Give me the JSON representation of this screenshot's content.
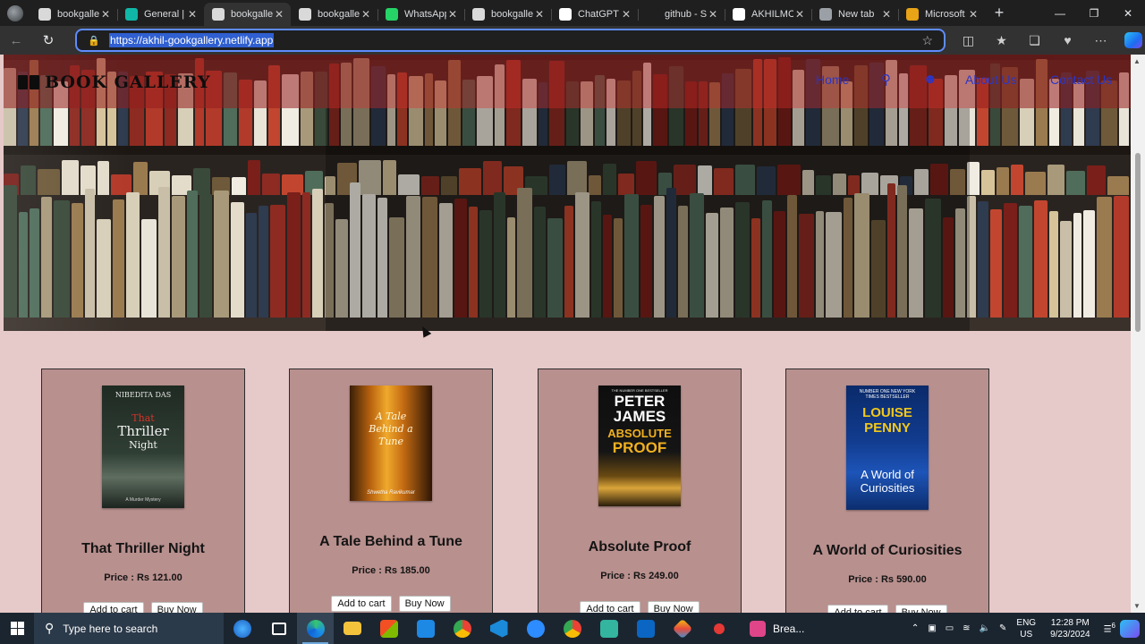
{
  "browser": {
    "tabs": [
      {
        "title": "bookgallery",
        "favicon": "bookgallery-favicon",
        "color": "#d9d9d9",
        "active": false
      },
      {
        "title": "General |",
        "favicon": "teal-diamond-favicon",
        "color": "#10b7a6",
        "active": false
      },
      {
        "title": "bookgallery",
        "favicon": "bookgallery-favicon",
        "color": "#d9d9d9",
        "active": true
      },
      {
        "title": "bookgallery",
        "favicon": "bookgallery-favicon",
        "color": "#d9d9d9",
        "active": false
      },
      {
        "title": "WhatsApp",
        "favicon": "whatsapp-favicon",
        "color": "#25d366",
        "active": false
      },
      {
        "title": "bookgallery",
        "favicon": "bookgallery-favicon",
        "color": "#d9d9d9",
        "active": false
      },
      {
        "title": "ChatGPT",
        "favicon": "chatgpt-favicon",
        "color": "#ffffff",
        "active": false
      },
      {
        "title": "github - S",
        "favicon": "search-favicon",
        "color": "#1f1f1f",
        "active": false
      },
      {
        "title": "AKHILMC",
        "favicon": "github-favicon",
        "color": "#ffffff",
        "active": false
      },
      {
        "title": "New tab",
        "favicon": "newtab-favicon",
        "color": "#9aa0a6",
        "active": false
      },
      {
        "title": "Microsoft",
        "favicon": "microsoft-rewards-favicon",
        "color": "#e8a317",
        "active": false
      }
    ],
    "url": "https://akhil-gookgallery.netlify.app"
  },
  "site": {
    "brand": "BOOK GALLERY",
    "nav": {
      "home": "Home",
      "about": "About Us",
      "contact": "Contact Us"
    },
    "accent_color": "#2a36c8",
    "page_background": "#e6c9c9",
    "card_background": "#b8908e"
  },
  "books": [
    {
      "title": "That Thriller Night",
      "price": "Price : Rs 121.00",
      "cover": {
        "author": "NIBEDITA DAS",
        "title_lines": [
          "That",
          "Thriller",
          "Night"
        ],
        "footer": "A Murder Mystery"
      },
      "add_label": "Add to cart",
      "buy_label": "Buy Now"
    },
    {
      "title": "A Tale Behind a Tune",
      "price": "Price : Rs 185.00",
      "cover": {
        "author": "",
        "title_lines": [
          "A Tale",
          "Behind a",
          "Tune"
        ],
        "footer": "Shwetha Ravikumar"
      },
      "add_label": "Add to cart",
      "buy_label": "Buy Now"
    },
    {
      "title": "Absolute Proof",
      "price": "Price : Rs 249.00",
      "cover": {
        "author": "PETER JAMES",
        "title_lines": [
          "ABSOLUTE",
          "PROOF"
        ],
        "footer": "THE NUMBER ONE BESTSELLER"
      },
      "add_label": "Add to cart",
      "buy_label": "Buy Now"
    },
    {
      "title": "A World of Curiosities",
      "price": "Price : Rs 590.00",
      "cover": {
        "author": "LOUISE PENNY",
        "title_lines": [
          "A World of",
          "Curiosities"
        ],
        "footer": "NUMBER ONE NEW YORK TIMES BESTSELLER"
      },
      "add_label": "Add to cart",
      "buy_label": "Buy Now"
    }
  ],
  "taskbar": {
    "search_placeholder": "Type here to search",
    "weather_label": "Brea...",
    "lang_top": "ENG",
    "lang_bottom": "US",
    "time": "12:28 PM",
    "date": "9/23/2024",
    "notification_count": "6"
  }
}
